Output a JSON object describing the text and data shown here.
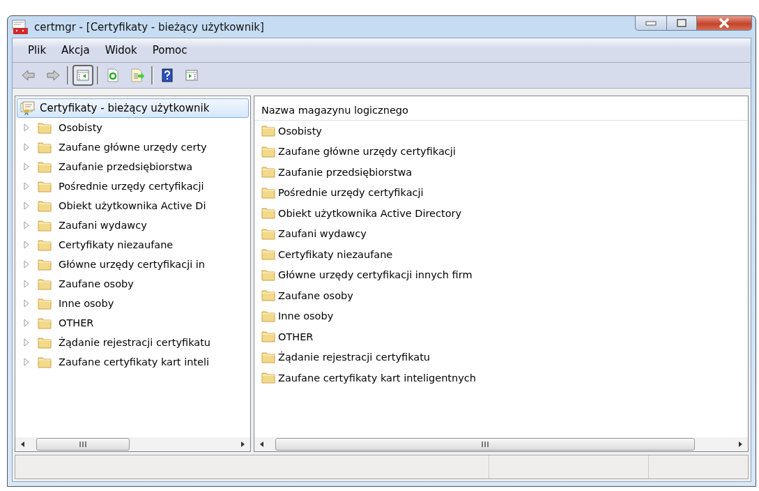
{
  "window": {
    "title": "certmgr - [Certyfikaty - bieżący użytkownik]"
  },
  "menu": [
    "Plik",
    "Akcja",
    "Widok",
    "Pomoc"
  ],
  "toolbar": [
    [
      {
        "kind": "back",
        "pressed": false
      },
      {
        "kind": "forward",
        "pressed": false
      }
    ],
    [
      {
        "kind": "tree",
        "pressed": true
      }
    ],
    [
      {
        "kind": "refresh",
        "pressed": false
      },
      {
        "kind": "export",
        "pressed": false
      }
    ],
    [
      {
        "kind": "help",
        "pressed": false
      },
      {
        "kind": "actionpane",
        "pressed": false
      }
    ]
  ],
  "tree": {
    "label": "Certyfikaty - bieżący użytkownik",
    "selected": true,
    "expanded": true,
    "children": [
      {
        "label": "Osobisty",
        "expanded": false
      },
      {
        "label": "Zaufane główne urzędy certy",
        "expanded": false
      },
      {
        "label": "Zaufanie przedsiębiorstwa",
        "expanded": false
      },
      {
        "label": "Pośrednie urzędy certyfikacji",
        "expanded": false
      },
      {
        "label": "Obiekt użytkownika Active Di",
        "expanded": false
      },
      {
        "label": "Zaufani wydawcy",
        "expanded": false
      },
      {
        "label": "Certyfikaty niezaufane",
        "expanded": false
      },
      {
        "label": "Główne urzędy certyfikacji in",
        "expanded": false
      },
      {
        "label": "Zaufane osoby",
        "expanded": false
      },
      {
        "label": "Inne osoby",
        "expanded": false
      },
      {
        "label": "OTHER",
        "expanded": false
      },
      {
        "label": "Żądanie rejestracji certyfikatu",
        "expanded": false
      },
      {
        "label": "Zaufane certyfikaty kart inteli",
        "expanded": false
      }
    ]
  },
  "list": {
    "columns": [
      "Nazwa magazynu logicznego"
    ],
    "rows": [
      "Osobisty",
      "Zaufane główne urzędy certyfikacji",
      "Zaufanie przedsiębiorstwa",
      "Pośrednie urzędy certyfikacji",
      "Obiekt użytkownika Active Directory",
      "Zaufani wydawcy",
      "Certyfikaty niezaufane",
      "Główne urzędy certyfikacji innych firm",
      "Zaufane osoby",
      "Inne osoby",
      "OTHER",
      "Żądanie rejestracji certyfikatu",
      "Zaufane certyfikaty kart inteligentnych"
    ]
  }
}
